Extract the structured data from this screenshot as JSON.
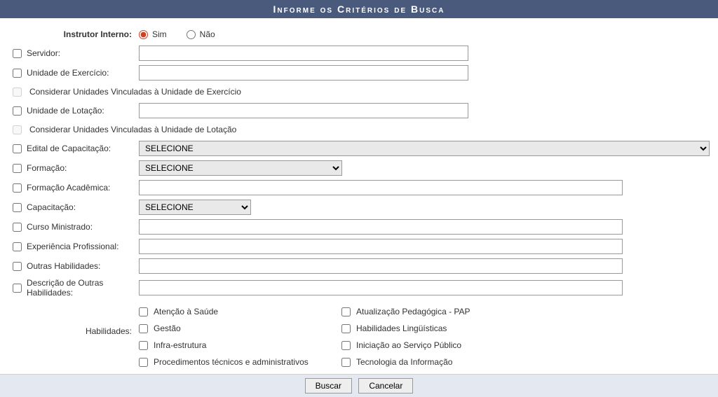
{
  "header": {
    "title": "Informe os Critérios de Busca"
  },
  "instrutor": {
    "label": "Instrutor Interno:",
    "optSim": "Sim",
    "optNao": "Não"
  },
  "fields": {
    "servidor": "Servidor:",
    "unidadeExercicio": "Unidade de Exercício:",
    "considerarExercicio": "Considerar Unidades Vinculadas à Unidade de Exercício",
    "unidadeLotacao": "Unidade de Lotação:",
    "considerarLotacao": "Considerar Unidades Vinculadas à Unidade de Lotação",
    "edital": "Edital de Capacitação:",
    "formacao": "Formação:",
    "formacaoAcademica": "Formação Acadêmica:",
    "capacitacao": "Capacitação:",
    "cursoMinistrado": "Curso Ministrado:",
    "experiencia": "Experiência Profissional:",
    "outrasHabilidades": "Outras Habilidades:",
    "descricaoOutras": "Descrição de Outras Habilidades:",
    "habilidadesLabel": "Habilidades:"
  },
  "selectPlaceholder": "SELECIONE",
  "habilidades": {
    "h0": "Atenção à Saúde",
    "h1": "Atualização Pedagógica - PAP",
    "h2": "Gestão",
    "h3": "Habilidades Lingüísticas",
    "h4": "Infra-estrutura",
    "h5": "Iniciação ao Serviço Público",
    "h6": "Procedimentos técnicos e administrativos",
    "h7": "Tecnologia da Informação"
  },
  "buttons": {
    "buscar": "Buscar",
    "cancelar": "Cancelar"
  }
}
